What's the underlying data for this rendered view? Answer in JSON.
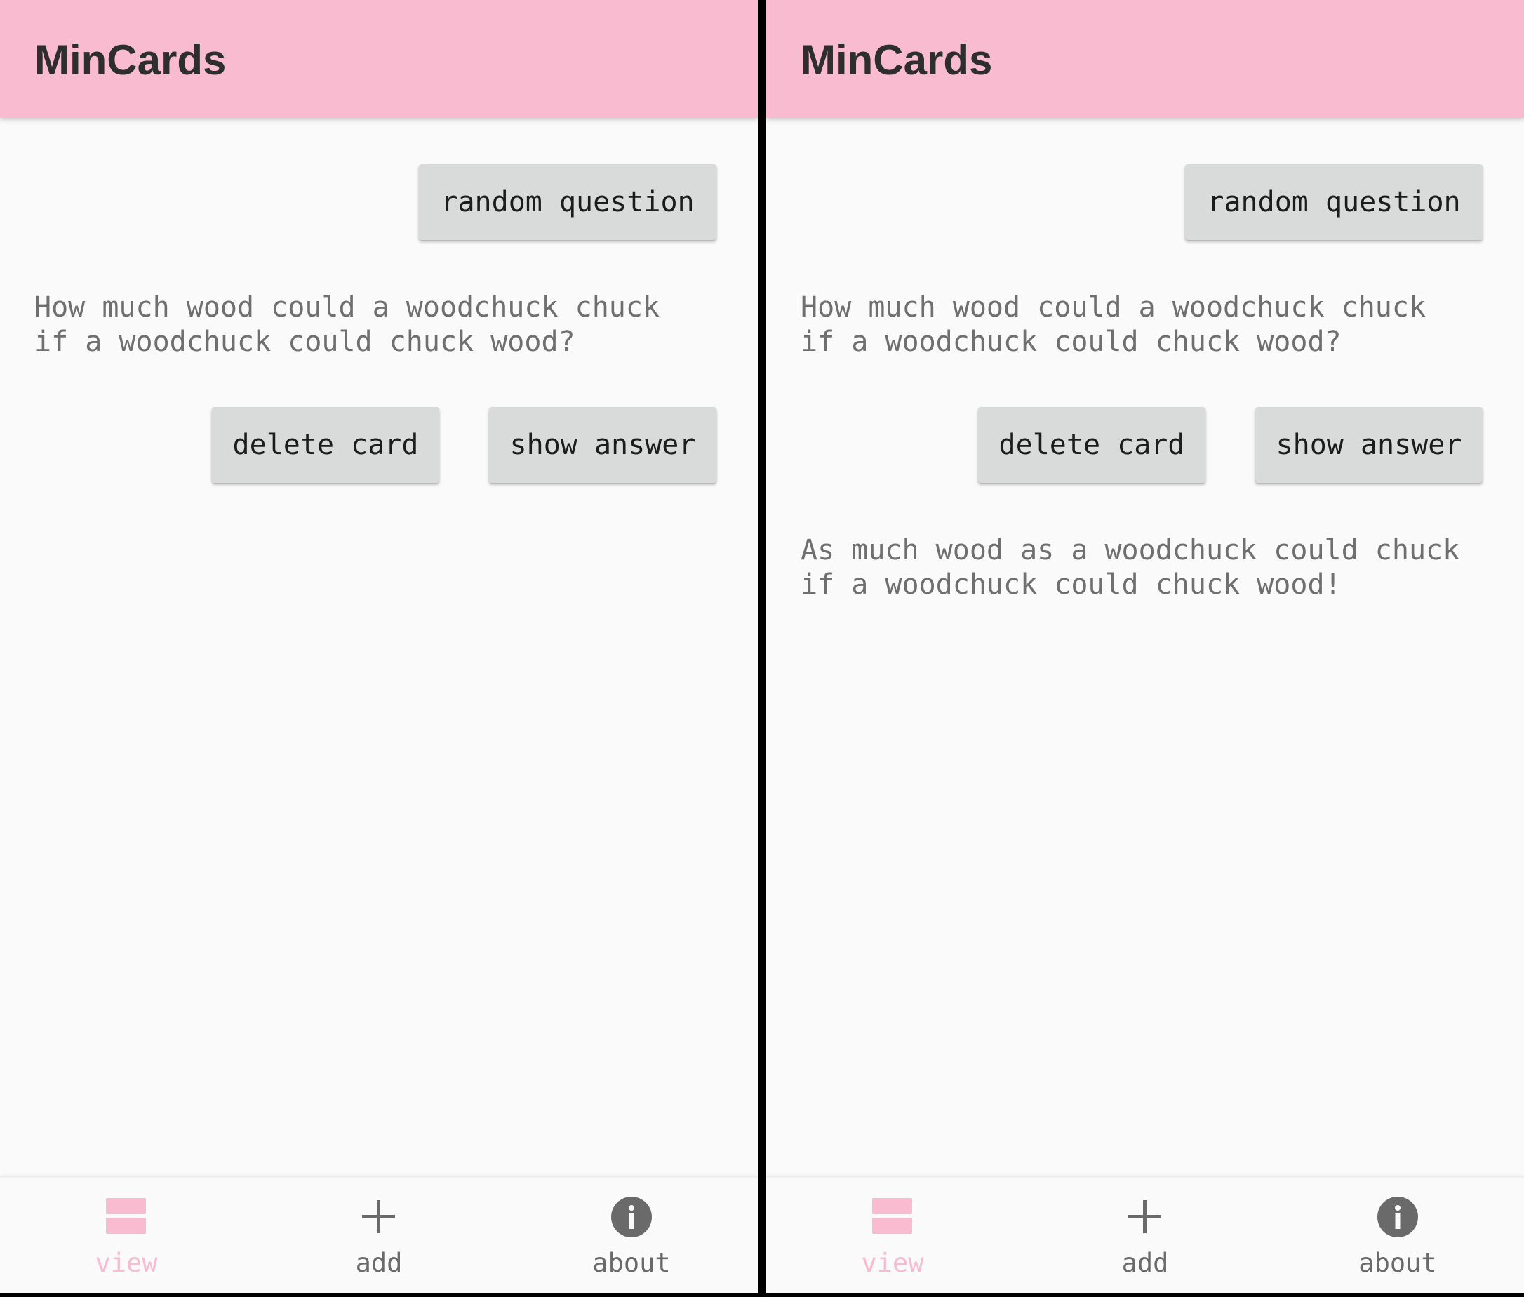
{
  "colors": {
    "app_bar": "#f9bbcf",
    "accent": "#f9bbcf",
    "background": "#fafafa",
    "button": "#d9dbda",
    "divider": "#000000",
    "inactive_icon": "#6a6a6a"
  },
  "screens": [
    {
      "title": "MinCards",
      "buttons": {
        "random": "random question",
        "delete": "delete card",
        "show": "show answer"
      },
      "question": "How much wood could a woodchuck chuck\nif a woodchuck could chuck wood?",
      "answer": "",
      "nav": [
        {
          "label": "view",
          "icon": "cards-icon",
          "active": true
        },
        {
          "label": "add",
          "icon": "plus-icon",
          "active": false
        },
        {
          "label": "about",
          "icon": "info-icon",
          "active": false
        }
      ]
    },
    {
      "title": "MinCards",
      "buttons": {
        "random": "random question",
        "delete": "delete card",
        "show": "show answer"
      },
      "question": "How much wood could a woodchuck chuck\nif a woodchuck could chuck wood?",
      "answer": "As much wood as a woodchuck could chuck\nif a woodchuck could chuck wood!",
      "nav": [
        {
          "label": "view",
          "icon": "cards-icon",
          "active": true
        },
        {
          "label": "add",
          "icon": "plus-icon",
          "active": false
        },
        {
          "label": "about",
          "icon": "info-icon",
          "active": false
        }
      ]
    }
  ]
}
